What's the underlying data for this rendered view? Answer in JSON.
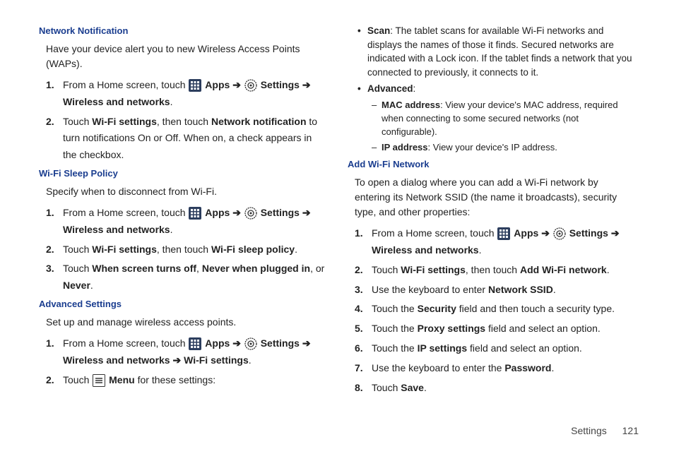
{
  "left": {
    "network_notification": {
      "heading": "Network Notification",
      "intro": "Have your device alert you to new Wireless Access Points (WAPs).",
      "steps": [
        {
          "pre": "From a Home screen, touch ",
          "apps": "Apps",
          "arrow1": " ➔ ",
          "settings": "Settings",
          "arrow2": " ➔ ",
          "wnl": "Wireless and networks",
          "period": "."
        },
        {
          "t1": "Touch ",
          "b1": "Wi-Fi settings",
          "t2": ", then touch ",
          "b2": "Network notification",
          "t3": " to turn notifications On or Off. When on, a check appears in the checkbox."
        }
      ]
    },
    "wifi_sleep": {
      "heading": "Wi-Fi Sleep Policy",
      "intro": "Specify when to disconnect from Wi-Fi.",
      "steps": [
        {
          "pre": "From a Home screen, touch ",
          "apps": "Apps",
          "arrow1": " ➔ ",
          "settings": "Settings",
          "arrow2": " ➔ ",
          "wnl": "Wireless and networks",
          "period": "."
        },
        {
          "t1": "Touch ",
          "b1": "Wi-Fi settings",
          "t2": ", then touch ",
          "b2": "Wi-Fi sleep policy",
          "t3": "."
        },
        {
          "t1": "Touch ",
          "b1": "When screen turns off",
          "t2": ", ",
          "b2": "Never when plugged in",
          "t3": ", or ",
          "b3": "Never",
          "t4": "."
        }
      ]
    },
    "advanced": {
      "heading": "Advanced Settings",
      "intro": "Set up and manage wireless access points.",
      "steps": [
        {
          "pre": "From a Home screen, touch ",
          "apps": "Apps",
          "arrow1": " ➔ ",
          "settings": "Settings",
          "arrow2": " ➔ ",
          "wnl": "Wireless and networks",
          "arrow3": " ➔ ",
          "wfs": "Wi-Fi settings",
          "period": "."
        },
        {
          "t1": "Touch ",
          "menu": "Menu",
          "t2": " for these settings:"
        }
      ]
    }
  },
  "right": {
    "bullets": {
      "scan": {
        "b": "Scan",
        "t": ": The tablet scans for available Wi-Fi networks and displays the names of those it finds. Secured networks are indicated with a Lock icon. If the tablet finds a network that you connected to previously, it connects to it."
      },
      "advanced": {
        "b": "Advanced",
        "t": ":"
      },
      "mac": {
        "b": "MAC address",
        "t": ": View your device's MAC address, required when connecting to some secured networks (not configurable)."
      },
      "ip": {
        "b": "IP address",
        "t": ": View your device's IP address."
      }
    },
    "add_wifi": {
      "heading": "Add Wi-Fi Network",
      "intro": "To open a dialog where you can add a Wi-Fi network by entering its Network SSID (the name it broadcasts), security type, and other properties:",
      "steps": [
        {
          "pre": "From a Home screen, touch ",
          "apps": "Apps",
          "arrow1": " ➔ ",
          "settings": "Settings",
          "arrow2": " ➔ ",
          "wnl": "Wireless and networks",
          "period": "."
        },
        {
          "t1": "Touch ",
          "b1": "Wi-Fi settings",
          "t2": ", then touch ",
          "b2": "Add Wi-Fi network",
          "t3": "."
        },
        {
          "t1": "Use the keyboard to enter ",
          "b1": "Network SSID",
          "t2": "."
        },
        {
          "t1": "Touch the ",
          "b1": "Security",
          "t2": " field and then touch a security type."
        },
        {
          "t1": "Touch the ",
          "b1": "Proxy settings",
          "t2": " field and select an option."
        },
        {
          "t1": "Touch the ",
          "b1": "IP settings",
          "t2": " field and select an option."
        },
        {
          "t1": "Use the keyboard to enter the ",
          "b1": "Password",
          "t2": "."
        },
        {
          "t1": "Touch ",
          "b1": "Save",
          "t2": "."
        }
      ]
    }
  },
  "footer": {
    "section": "Settings",
    "page": "121"
  },
  "icons": {
    "apps": "apps-icon",
    "settings": "settings-icon",
    "menu": "menu-icon"
  }
}
